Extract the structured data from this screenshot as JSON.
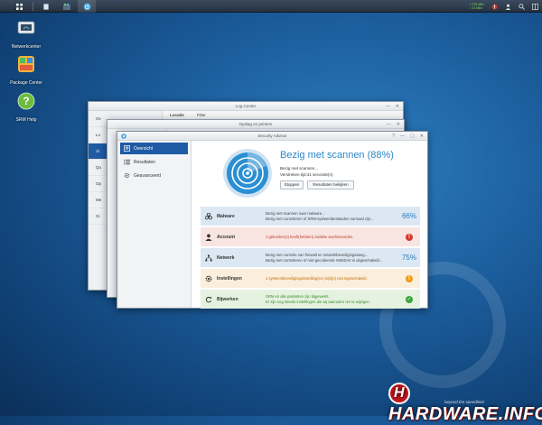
{
  "taskbar": {
    "status_line1": "• 215 kB/s",
    "status_line2": "• 13 kB/s"
  },
  "desktop": {
    "icons": [
      {
        "label": "Netwerkcenter"
      },
      {
        "label": "Package Center"
      },
      {
        "label": "SRM Help"
      }
    ]
  },
  "log_center": {
    "title": "Log Center",
    "tabs": [
      "Locatie",
      "Filter"
    ],
    "side_items": [
      "Ov",
      "Lo",
      "Vi",
      "Qu",
      "Op",
      "Me",
      "Gi"
    ]
  },
  "sync_window": {
    "title": "Opslag en printers"
  },
  "security_advisor": {
    "title": "Security Advisor",
    "window_controls": [
      "?",
      "—",
      "▢",
      "✕"
    ],
    "nav": [
      {
        "label": "Overzicht",
        "active": true
      },
      {
        "label": "Resultaten",
        "active": false
      },
      {
        "label": "Geavanceerd",
        "active": false
      }
    ],
    "scan_title": "Bezig met scannen (88%)",
    "scan_progress_percent": 88,
    "scan_line1": "Bezig met scannen...",
    "scan_line2": "Verstreken tijd:41 seconde(n)",
    "buttons": {
      "stop": "Stoppen",
      "results": "Resultaten bekijken"
    },
    "rows": [
      {
        "label": "Malware",
        "desc1": "Bezig met scannen naar malware...",
        "desc2": "Bezig met controleren of SRM-systeembestanden normaal zijn...",
        "status": "66%",
        "tone": "blue"
      },
      {
        "label": "Account",
        "desc1": "1 gebruiker(s) heeft(hebben) zwakke wachtwoorden.",
        "desc2": "",
        "status": "!",
        "tone": "red"
      },
      {
        "label": "Netwerk",
        "desc1": "Bezig met controle van firewall en netwerkbeveiligingsaang...",
        "desc2": "Bezig met controleren of niet-gecodeerde WebDAV is uitgeschakeld...",
        "status": "75%",
        "tone": "blue"
      },
      {
        "label": "Instellingen",
        "desc1": "1 systeembeveiligingsinstelling(en) is(zijn) niet ingeschakeld.",
        "desc2": "",
        "status": "!",
        "tone": "orange"
      },
      {
        "label": "Bijwerken",
        "desc1": "SRM en alle pakketten zijn bijgewerkt.",
        "desc2": "Er zijn nog steeds instellingen die wij aanraden om te wijzigen.",
        "status": "✓",
        "tone": "green"
      }
    ]
  },
  "watermark": {
    "brand": "HARDWARE.INFO",
    "tagline": "beyond the speedlimit"
  },
  "colors": {
    "accent": "#1f5ba4",
    "scan_blue": "#2a88c7",
    "red": "#d43a2a",
    "orange": "#ef9a1a",
    "green": "#3aa33a"
  }
}
